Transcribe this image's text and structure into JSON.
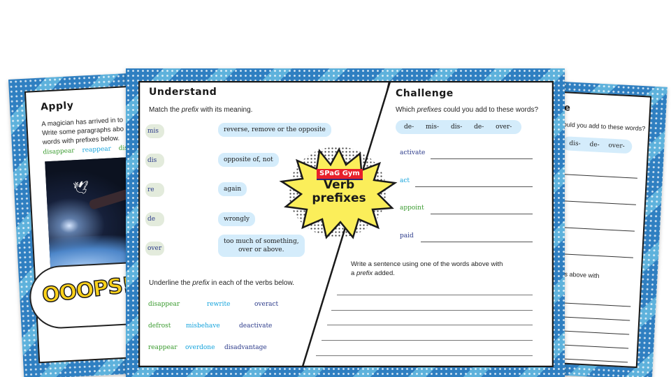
{
  "badge": {
    "brand": "SPaG Gym",
    "title_line1": "Verb",
    "title_line2": "prefixes"
  },
  "apply": {
    "heading": "Apply",
    "text_lines": [
      "A magician has arrived in to",
      "Write some paragraphs abo",
      "words with prefixes below."
    ],
    "words": [
      {
        "text": "disappear",
        "color": "green"
      },
      {
        "text": "reappear",
        "color": "cyan"
      },
      {
        "text": "dis",
        "color": "green"
      }
    ],
    "sticker_text": "OOOPS!"
  },
  "understand": {
    "heading": "Understand",
    "match_instruction_pre": "Match the ",
    "match_instruction_em": "prefix",
    "match_instruction_post": " with its meaning.",
    "prefixes": [
      "mis",
      "dis",
      "re",
      "de",
      "over"
    ],
    "meanings": [
      "reverse, remove or the opposite",
      "opposite of, not",
      "again",
      "wrongly",
      "too much of something,",
      "over or above."
    ],
    "underline_instruction_pre": "Underline the ",
    "underline_instruction_em": "prefix",
    "underline_instruction_post": " in each of the verbs below.",
    "verbs": [
      {
        "text": "disappear",
        "color": "green"
      },
      {
        "text": "rewrite",
        "color": "cyan"
      },
      {
        "text": "overact",
        "color": "navy"
      },
      {
        "text": "defrost",
        "color": "green"
      },
      {
        "text": "misbehave",
        "color": "cyan"
      },
      {
        "text": "deactivate",
        "color": "navy"
      },
      {
        "text": "reappear",
        "color": "green"
      },
      {
        "text": "overdone",
        "color": "cyan"
      },
      {
        "text": "disadvantage",
        "color": "navy"
      }
    ]
  },
  "challenge": {
    "heading": "Challenge",
    "question_pre": "Which ",
    "question_em": "prefixes",
    "question_post": " could you add to these words?",
    "prefix_options": [
      "de-",
      "mis-",
      "dis-",
      "de-",
      "over-"
    ],
    "words": [
      {
        "text": "activate",
        "color": "navy"
      },
      {
        "text": "act",
        "color": "cyan"
      },
      {
        "text": "appoint",
        "color": "green"
      },
      {
        "text": "paid",
        "color": "navy"
      }
    ],
    "sentence_instruction_line1": "Write a sentence using one of the words above with",
    "sentence_instruction_pre": "a ",
    "sentence_instruction_em": "prefix",
    "sentence_instruction_post": " added."
  },
  "back_sheet": {
    "heading_fragment": "e",
    "question_fragment": "ould you add to these words?",
    "prefix_options": [
      "dis-",
      "de-",
      "over-"
    ],
    "sentence_fragment": "ords above with"
  },
  "colors": {
    "green": "#3a9b2f",
    "cyan": "#14a3dc",
    "navy": "#2b3a8a",
    "frame_blue": "#2f7fc1",
    "chip_blue": "#d4ecfb",
    "chip_green": "#e3ebdc",
    "badge_yellow": "#fbee5a",
    "brand_red": "#e8202a"
  }
}
